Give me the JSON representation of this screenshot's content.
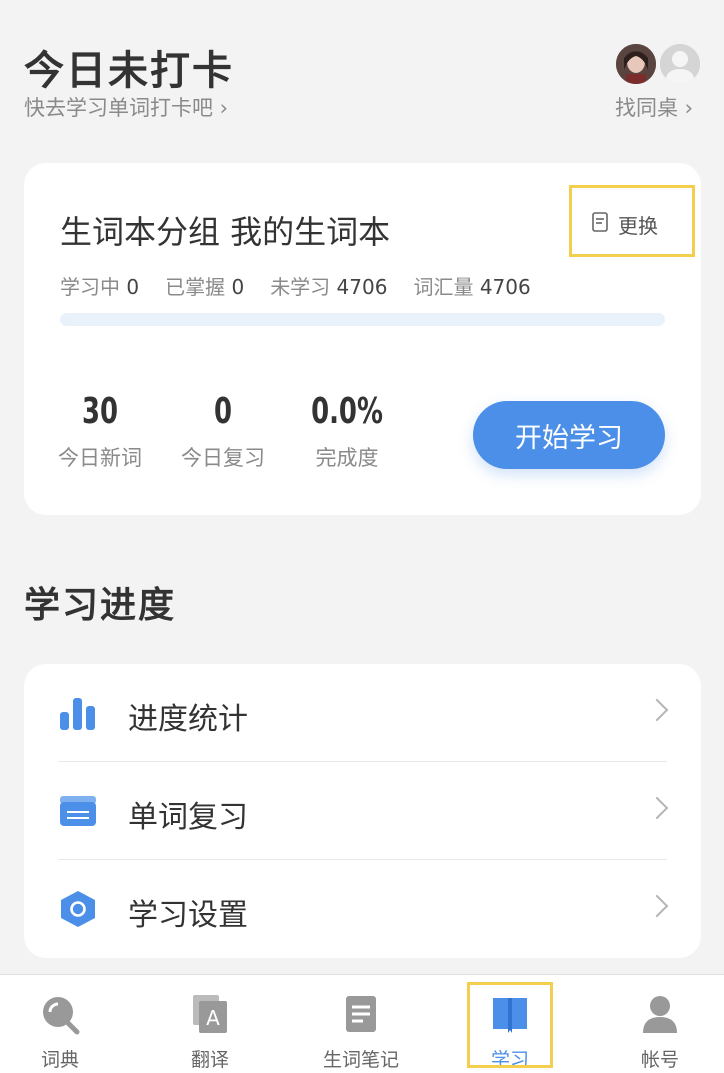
{
  "header": {
    "title": "今日未打卡",
    "subtitle": "快去学习单词打卡吧 ›",
    "find_desk": "找同桌 ›"
  },
  "wordbook": {
    "title": "生词本分组 我的生词本",
    "change_label": "更换",
    "stats": [
      {
        "label": "学习中",
        "value": "0"
      },
      {
        "label": "已掌握",
        "value": "0"
      },
      {
        "label": "未学习",
        "value": "4706"
      },
      {
        "label": "词汇量",
        "value": "4706"
      }
    ],
    "progress_fraction": 0.0,
    "metrics": [
      {
        "value": "30",
        "label": "今日新词"
      },
      {
        "value": "0",
        "label": "今日复习"
      },
      {
        "value": "0.0%",
        "label": "完成度"
      }
    ],
    "start_button": "开始学习"
  },
  "progress_section": {
    "title": "学习进度",
    "items": [
      {
        "label": "进度统计",
        "icon": "bar-chart-icon"
      },
      {
        "label": "单词复习",
        "icon": "card-icon"
      },
      {
        "label": "学习设置",
        "icon": "hexagon-settings-icon"
      }
    ]
  },
  "tabbar": {
    "tabs": [
      {
        "label": "词典",
        "icon": "magnifier-icon",
        "active": false
      },
      {
        "label": "翻译",
        "icon": "translate-icon",
        "active": false
      },
      {
        "label": "生词笔记",
        "icon": "note-icon",
        "active": false
      },
      {
        "label": "学习",
        "icon": "book-icon",
        "active": true
      },
      {
        "label": "帐号",
        "icon": "person-icon",
        "active": false
      }
    ]
  },
  "colors": {
    "accent": "#4b8fe8",
    "highlight": "#f4cf4f",
    "background": "#f3f3f3"
  }
}
